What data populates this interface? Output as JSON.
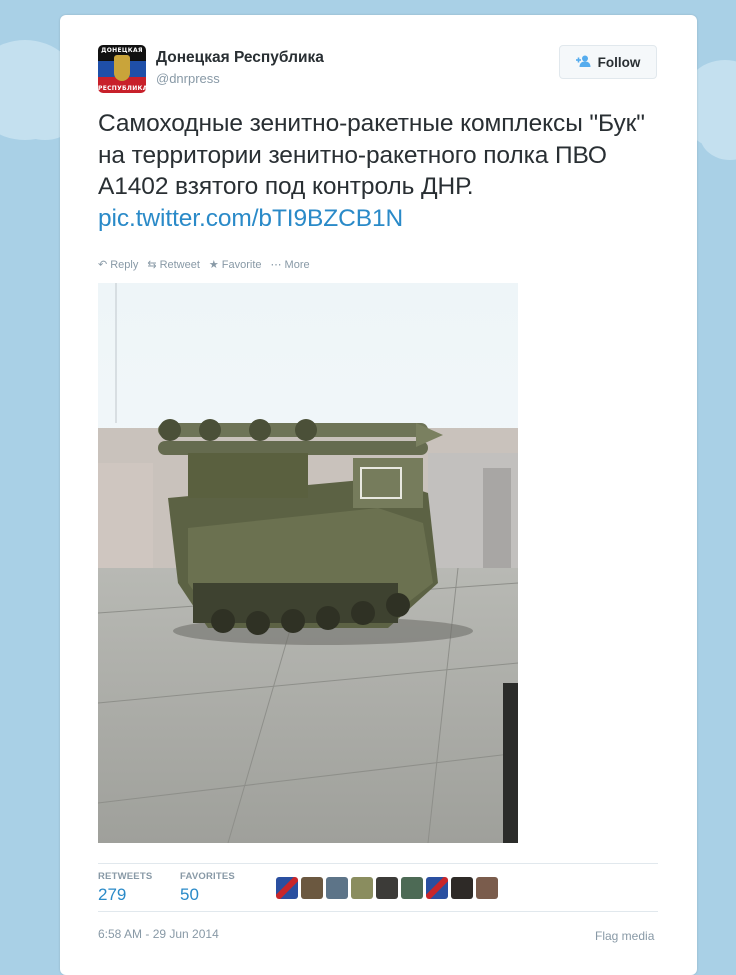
{
  "tweet": {
    "author_name": "Донецкая Республика",
    "handle": "@dnrpress",
    "avatar_text_top": "ДОНЕЦКАЯ",
    "avatar_text_bottom": "РЕСПУБЛИКА",
    "follow_label": "Follow",
    "text": "Самоходные зенитно-ракетные комплексы \"Бук\" на территории зенитно-ракетного полка ПВО А1402 взятого под контроль ДНР.",
    "link": "pic.twitter.com/bTI9BZCB1N",
    "actions": {
      "reply": "Reply",
      "retweet": "Retweet",
      "favorite": "Favorite",
      "more": "More"
    },
    "stats": {
      "retweets_label": "RETWEETS",
      "retweets": "279",
      "favorites_label": "FAVORITES",
      "favorites": "50"
    },
    "timestamp": "6:58 AM - 29 Jun 2014",
    "flag_label": "Flag media"
  },
  "colors": {
    "background": "#a9d0e6",
    "link": "#2a8ac8",
    "muted": "#8899a6",
    "text": "#292f33",
    "follow_icon": "#55acee"
  },
  "icons": {
    "follow": "add-user-icon",
    "reply": "reply-arrow-icon",
    "retweet": "retweet-icon",
    "favorite": "star-icon",
    "more": "ellipsis-icon"
  }
}
